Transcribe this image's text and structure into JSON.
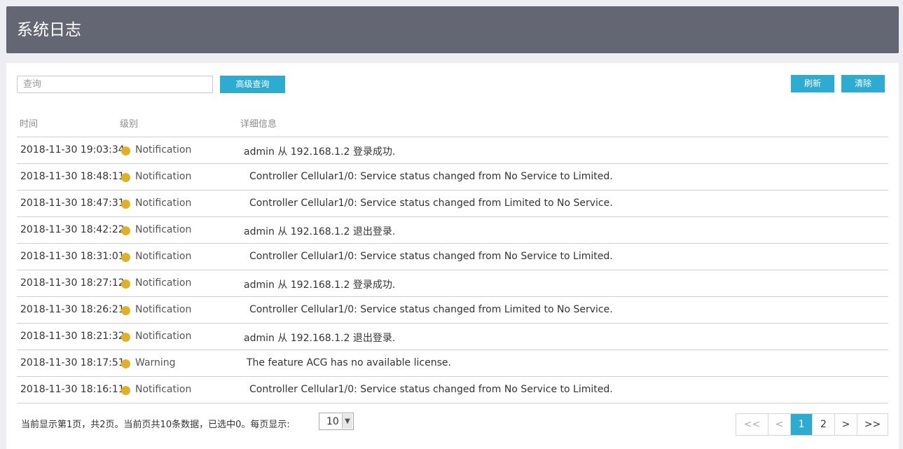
{
  "header": {
    "title": "系统日志"
  },
  "toolbar": {
    "search_placeholder": "查询",
    "advanced_search_label": "高级查询",
    "refresh_label": "刷新",
    "clear_label": "清除"
  },
  "table": {
    "columns": [
      "时间",
      "级别",
      "详细信息"
    ],
    "rows": [
      {
        "time": "2018-11-30 19:03:34",
        "level": "Notification",
        "detail": "admin 从 192.168.1.2 登录成功."
      },
      {
        "time": "2018-11-30 18:48:11",
        "level": "Notification",
        "detail": "Controller Cellular1/0: Service status changed from No Service to Limited."
      },
      {
        "time": "2018-11-30 18:47:31",
        "level": "Notification",
        "detail": "Controller Cellular1/0: Service status changed from Limited to No Service."
      },
      {
        "time": "2018-11-30 18:42:22",
        "level": "Notification",
        "detail": "admin 从 192.168.1.2 退出登录."
      },
      {
        "time": "2018-11-30 18:31:01",
        "level": "Notification",
        "detail": "Controller Cellular1/0: Service status changed from No Service to Limited."
      },
      {
        "time": "2018-11-30 18:27:12",
        "level": "Notification",
        "detail": "admin 从 192.168.1.2 登录成功."
      },
      {
        "time": "2018-11-30 18:26:21",
        "level": "Notification",
        "detail": "Controller Cellular1/0: Service status changed from Limited to No Service."
      },
      {
        "time": "2018-11-30 18:21:32",
        "level": "Notification",
        "detail": "admin 从 192.168.1.2 退出登录."
      },
      {
        "time": "2018-11-30 18:17:51",
        "level": "Warning",
        "detail": "The feature ACG has no available license."
      },
      {
        "time": "2018-11-30 18:16:11",
        "level": "Notification",
        "detail": "Controller Cellular1/0: Service status changed from No Service to Limited."
      }
    ]
  },
  "footer": {
    "summary": "当前显示第1页，共2页。当前页共10条数据，已选中0。每页显示:",
    "page_size": "10"
  },
  "pagination": {
    "first": "<<",
    "prev": "<",
    "pages": [
      "1",
      "2"
    ],
    "current": "1",
    "next": ">",
    "last": ">>"
  },
  "colors": {
    "header_bg": "#656674",
    "accent": "#2eabd0",
    "level_dot": "#e0b128"
  }
}
